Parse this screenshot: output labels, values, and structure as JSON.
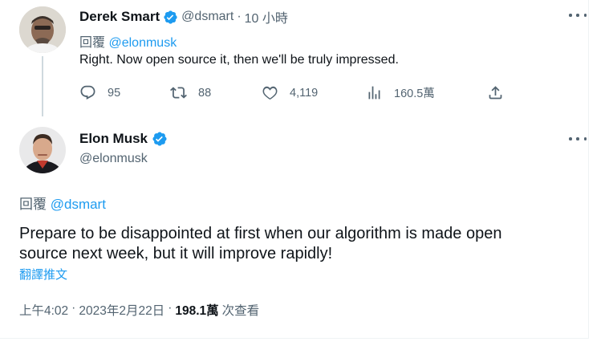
{
  "reply_tweet": {
    "author_name": "Derek Smart",
    "author_handle": "@dsmart",
    "separator": "·",
    "time_ago": "10 小時",
    "reply_label": "回覆",
    "reply_to": "@elonmusk",
    "text": "Right. Now open source it, then we'll be truly impressed.",
    "stats": {
      "replies": "95",
      "retweets": "88",
      "likes": "4,119",
      "views": "160.5萬"
    }
  },
  "main_tweet": {
    "author_name": "Elon Musk",
    "author_handle": "@elonmusk",
    "reply_label": "回覆",
    "reply_to": "@dsmart",
    "text_line1": "Prepare to be disappointed at first when our algorithm is made open",
    "text_line2": "source next week, but it will improve rapidly!",
    "translate_label": "翻譯推文",
    "time": "上午4:02",
    "date": "2023年2月22日",
    "separator": "·",
    "views_count": "198.1萬",
    "views_label": "次查看"
  },
  "colors": {
    "accent": "#1d9bf0",
    "muted": "#536471",
    "text": "#0f1419"
  },
  "icons": [
    "verified-badge-icon",
    "more-icon",
    "reply-icon",
    "retweet-icon",
    "like-icon",
    "views-icon",
    "share-icon"
  ]
}
